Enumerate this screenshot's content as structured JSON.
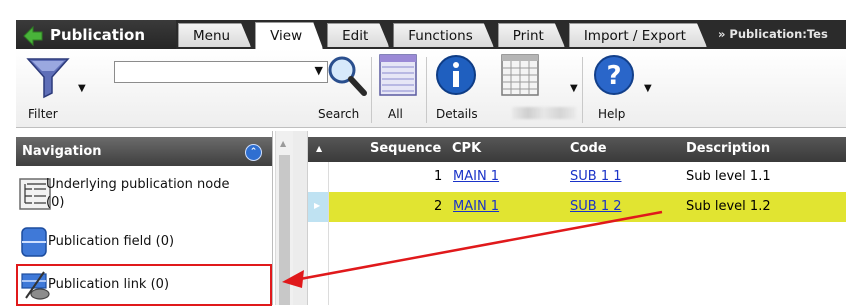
{
  "app": {
    "title": "Publication",
    "tabs": [
      "Menu",
      "View",
      "Edit",
      "Functions",
      "Print",
      "Import / Export"
    ],
    "active_tab": "View",
    "breadcrumb": "» Publication:Tes"
  },
  "ribbon": {
    "filter_label": "Filter",
    "search_label": "Search",
    "all_label": "All",
    "details_label": "Details",
    "help_label": "Help",
    "combo_value": ""
  },
  "navigation": {
    "title": "Navigation",
    "items": [
      {
        "label_line1": "Underlying publication node",
        "label_line2": "(0)",
        "icon": "tree-node-icon"
      },
      {
        "label": "Publication field (0)",
        "icon": "field-icon"
      },
      {
        "label": "Publication link (0)",
        "icon": "link-icon",
        "highlighted": true
      }
    ]
  },
  "grid": {
    "columns": [
      "Sequence",
      "CPK",
      "Code",
      "Description"
    ],
    "rows": [
      {
        "sequence": "1",
        "cpk": "MAIN 1",
        "code": "SUB 1 1",
        "description": "Sub level 1.1",
        "selected": false
      },
      {
        "sequence": "2",
        "cpk": "MAIN 1",
        "code": "SUB 1 2",
        "description": "Sub level 1.2",
        "selected": true
      }
    ]
  },
  "colors": {
    "selected_row": "#e1e431",
    "annotation": "#e0191b",
    "header_dark": "#3a3a3a"
  }
}
